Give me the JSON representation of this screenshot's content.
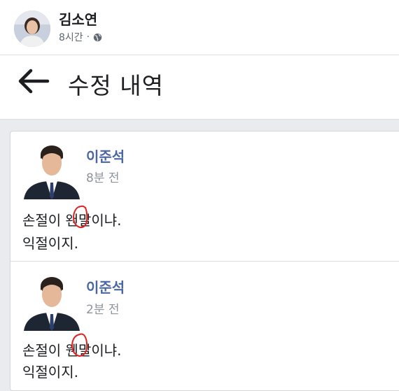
{
  "header": {
    "author_name": "김소연",
    "time": "8시간",
    "separator": "·"
  },
  "history": {
    "title": "수정 내역"
  },
  "revisions": [
    {
      "author": "이준석",
      "time": "8분 전",
      "line1": "손절이 왠말이냐.",
      "line2": "익절이지."
    },
    {
      "author": "이준석",
      "time": "2분 전",
      "line1": "손절이 웬말이냐.",
      "line2": "익절이지."
    }
  ],
  "colors": {
    "author_link": "#4b67a1",
    "annotation_circle": "#e02020"
  }
}
